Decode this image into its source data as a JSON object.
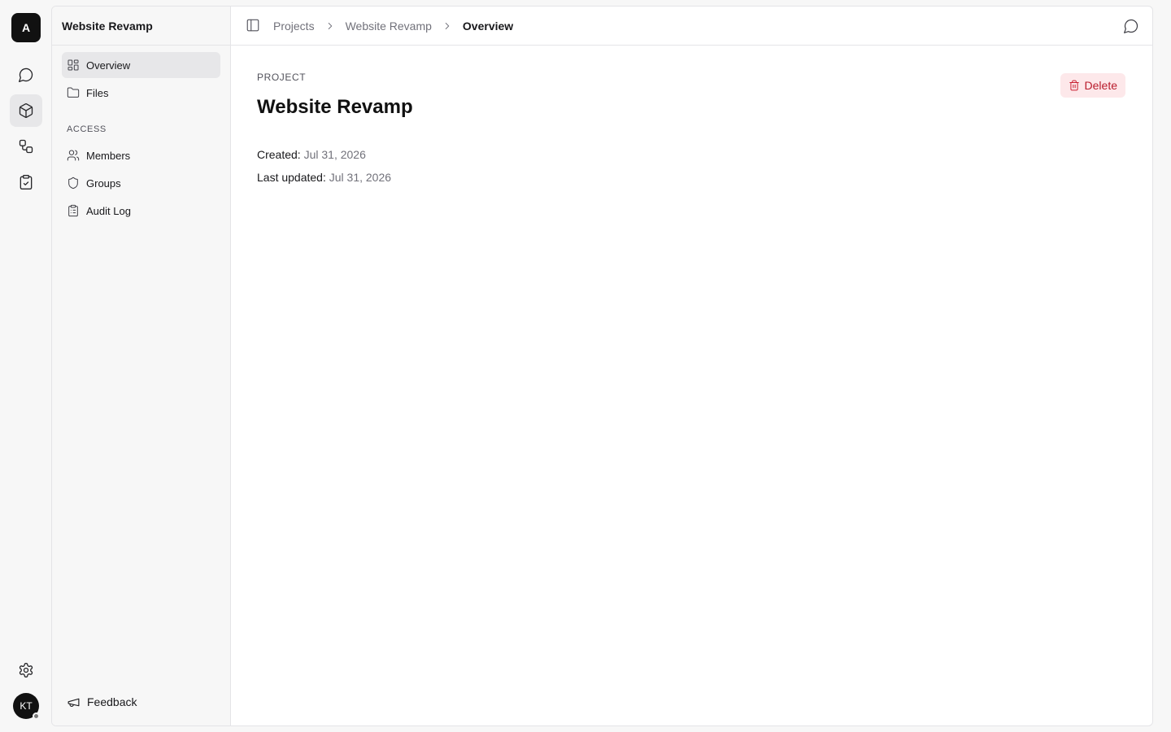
{
  "workspace": {
    "logo_letter": "A"
  },
  "rail": {
    "items": [
      {
        "icon": "chat-icon",
        "active": false
      },
      {
        "icon": "box-icon",
        "active": true
      },
      {
        "icon": "workflow-icon",
        "active": false
      },
      {
        "icon": "clipboard-check-icon",
        "active": false
      }
    ],
    "settings_icon": "gear-icon",
    "user_initials": "KT"
  },
  "sidebar": {
    "title": "Website Revamp",
    "items": [
      {
        "label": "Overview",
        "icon": "dashboard-icon",
        "active": true
      },
      {
        "label": "Files",
        "icon": "folder-icon",
        "active": false
      }
    ],
    "access_label": "ACCESS",
    "access_items": [
      {
        "label": "Members",
        "icon": "users-icon"
      },
      {
        "label": "Groups",
        "icon": "shield-icon"
      },
      {
        "label": "Audit Log",
        "icon": "clipboard-list-icon"
      }
    ],
    "feedback_label": "Feedback"
  },
  "breadcrumb": {
    "items": [
      "Projects",
      "Website Revamp",
      "Overview"
    ]
  },
  "project": {
    "eyebrow": "PROJECT",
    "title": "Website Revamp",
    "created_label": "Created:",
    "created_value": "Jul 31, 2026",
    "updated_label": "Last updated:",
    "updated_value": "Jul 31, 2026",
    "delete_label": "Delete"
  },
  "colors": {
    "accent_dark": "#111111",
    "danger": "#b91c2c",
    "danger_bg": "#fde8ea"
  }
}
